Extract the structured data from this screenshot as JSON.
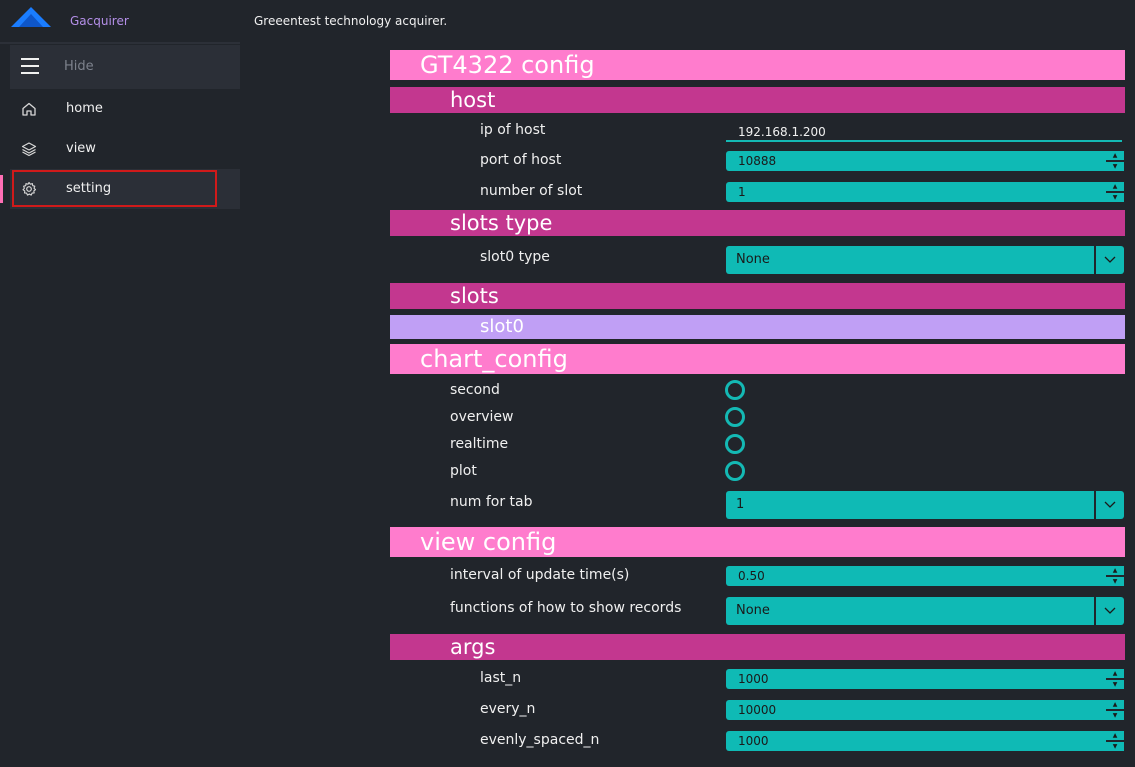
{
  "app": {
    "name": "Gacquirer",
    "title": "Greeentest technology acquirer."
  },
  "sidebar": {
    "hide_label": "Hide",
    "items": [
      {
        "label": "home",
        "icon": "home-icon"
      },
      {
        "label": "view",
        "icon": "layers-icon"
      },
      {
        "label": "setting",
        "icon": "gear-icon"
      }
    ],
    "active": "setting"
  },
  "config": {
    "gt_header": "GT4322 config",
    "host": {
      "header": "host",
      "ip_label": "ip of host",
      "ip_value": "192.168.1.200",
      "port_label": "port of host",
      "port_value": "10888",
      "slot_num_label": "number of slot",
      "slot_num_value": "1"
    },
    "slots_type": {
      "header": "slots type",
      "slot0_label": "slot0 type",
      "slot0_value": "None"
    },
    "slots": {
      "header": "slots",
      "slot0": "slot0"
    },
    "chart_config": {
      "header": "chart_config",
      "second": "second",
      "overview": "overview",
      "realtime": "realtime",
      "plot": "plot",
      "num_tab_label": "num for tab",
      "num_tab_value": "1"
    },
    "view_config": {
      "header": "view config",
      "interval_label": "interval of update time(s)",
      "interval_value": "0.50",
      "functions_label": "functions of how to show records",
      "functions_value": "None"
    },
    "args": {
      "header": "args",
      "last_n_label": "last_n",
      "last_n_value": "1000",
      "every_n_label": "every_n",
      "every_n_value": "10000",
      "evenly_label": "evenly_spaced_n",
      "evenly_value": "1000"
    }
  },
  "colors": {
    "accent_teal": "#0fbab5",
    "header_pink": "#ff7ccd",
    "header_magenta": "#c3378f",
    "header_lavender": "#c09ff5",
    "selection_red": "#d01a1a"
  }
}
